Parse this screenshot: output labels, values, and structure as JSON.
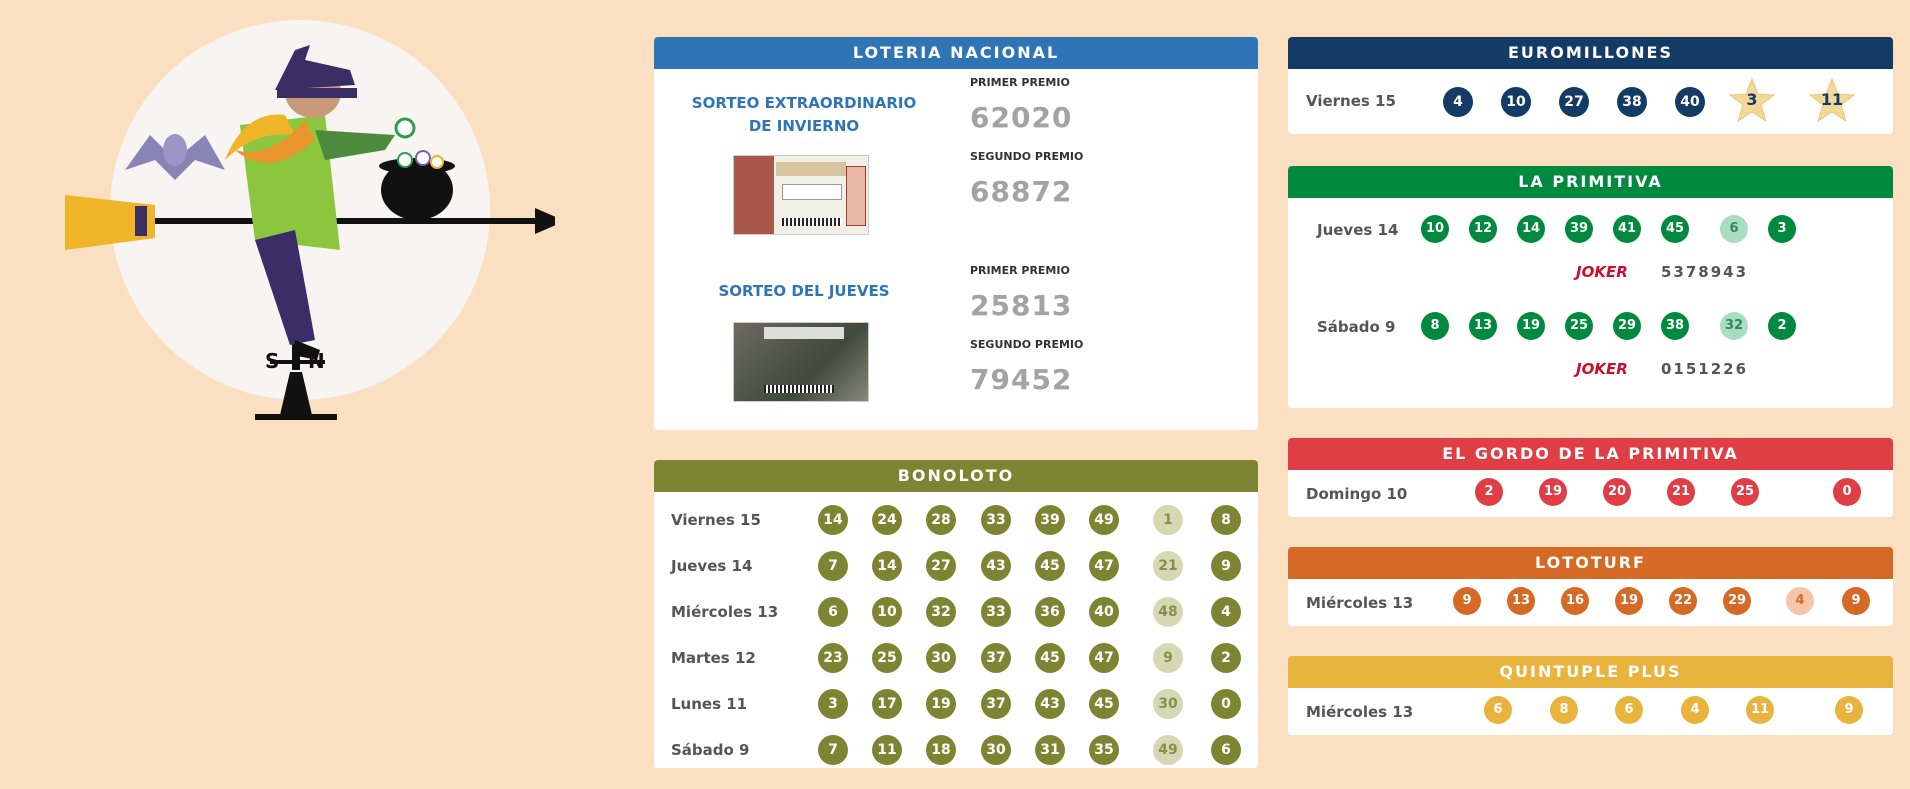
{
  "colors": {
    "background": "#fadfc1",
    "loteria_head": "#2f75b5",
    "bonoloto": "#7e8532",
    "bonoloto_light": "#d6d8b4",
    "euromillones": "#143a66",
    "euro_star": "#f2d99a",
    "primitiva": "#00893f",
    "primitiva_light": "#a9dcc1",
    "gordo": "#df3e45",
    "lototurf": "#d56a27",
    "lototurf_light": "#f6c4a7",
    "quintuple": "#e8b43e"
  },
  "illustration": {
    "weathervane_s": "S",
    "weathervane_n": "N"
  },
  "loteria": {
    "title": "LOTERIA NACIONAL",
    "draws": [
      {
        "name": "SORTEO EXTRAORDINARIO DE INVIERNO",
        "first_label": "PRIMER PREMIO",
        "first": "62020",
        "second_label": "SEGUNDO PREMIO",
        "second": "68872"
      },
      {
        "name": "SORTEO DEL JUEVES",
        "first_label": "PRIMER PREMIO",
        "first": "25813",
        "second_label": "SEGUNDO PREMIO",
        "second": "79452"
      }
    ]
  },
  "bonoloto": {
    "title": "BONOLOTO",
    "rows": [
      {
        "day": "Viernes 15",
        "numbers": [
          "14",
          "24",
          "28",
          "33",
          "39",
          "49"
        ],
        "complementario": "1",
        "reintegro": "8"
      },
      {
        "day": "Jueves 14",
        "numbers": [
          "7",
          "14",
          "27",
          "43",
          "45",
          "47"
        ],
        "complementario": "21",
        "reintegro": "9"
      },
      {
        "day": "Miércoles 13",
        "numbers": [
          "6",
          "10",
          "32",
          "33",
          "36",
          "40"
        ],
        "complementario": "48",
        "reintegro": "4"
      },
      {
        "day": "Martes 12",
        "numbers": [
          "23",
          "25",
          "30",
          "37",
          "45",
          "47"
        ],
        "complementario": "9",
        "reintegro": "2"
      },
      {
        "day": "Lunes 11",
        "numbers": [
          "3",
          "17",
          "19",
          "37",
          "43",
          "45"
        ],
        "complementario": "30",
        "reintegro": "0"
      },
      {
        "day": "Sábado 9",
        "numbers": [
          "7",
          "11",
          "18",
          "30",
          "31",
          "35"
        ],
        "complementario": "49",
        "reintegro": "6"
      }
    ]
  },
  "euromillones": {
    "title": "EUROMILLONES",
    "day": "Viernes 15",
    "numbers": [
      "4",
      "10",
      "27",
      "38",
      "40"
    ],
    "stars": [
      "3",
      "11"
    ]
  },
  "primitiva": {
    "title": "LA PRIMITIVA",
    "rows": [
      {
        "day": "Jueves 14",
        "numbers": [
          "10",
          "12",
          "14",
          "39",
          "41",
          "45"
        ],
        "complementario": "6",
        "reintegro": "3",
        "joker_label": "JOKER",
        "joker": "5378943"
      },
      {
        "day": "Sábado 9",
        "numbers": [
          "8",
          "13",
          "19",
          "25",
          "29",
          "38"
        ],
        "complementario": "32",
        "reintegro": "2",
        "joker_label": "JOKER",
        "joker": "0151226"
      }
    ]
  },
  "gordo": {
    "title": "EL GORDO DE LA PRIMITIVA",
    "day": "Domingo 10",
    "numbers": [
      "2",
      "19",
      "20",
      "21",
      "25"
    ],
    "clave": "0"
  },
  "lototurf": {
    "title": "LOTOTURF",
    "day": "Miércoles 13",
    "numbers": [
      "9",
      "13",
      "16",
      "19",
      "22",
      "29"
    ],
    "caballo": "4",
    "reintegro": "9"
  },
  "quintuple": {
    "title": "QUINTUPLE PLUS",
    "day": "Miércoles 13",
    "numbers": [
      "6",
      "8",
      "6",
      "4",
      "11"
    ],
    "reintegro": "9"
  }
}
